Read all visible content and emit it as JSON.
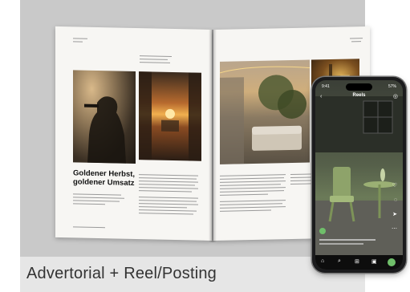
{
  "caption": "Advertorial + Reel/Posting",
  "magazine": {
    "headline": "Goldener Herbst, goldener Umsatz"
  },
  "phone": {
    "reel_title": "Reels",
    "time": "9:41",
    "battery": "57%"
  },
  "colors": {
    "card_bg": "#c9c9c9",
    "footer_bg": "#e6e6e6",
    "caption_text": "#333333"
  },
  "icons": [
    "back-arrow-icon",
    "camera-icon",
    "heart-icon",
    "comment-icon",
    "share-icon",
    "home-icon",
    "search-icon",
    "add-icon",
    "reels-icon",
    "profile-icon"
  ]
}
